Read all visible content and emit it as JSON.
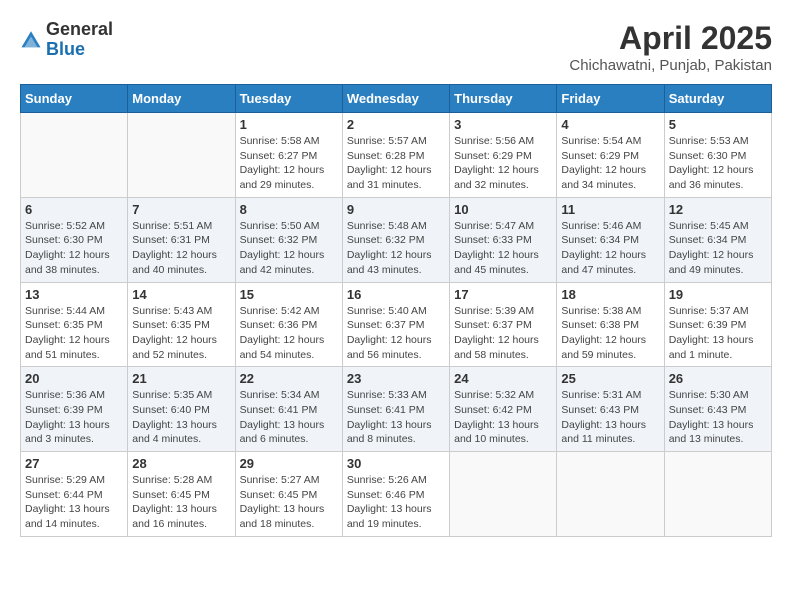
{
  "header": {
    "logo_general": "General",
    "logo_blue": "Blue",
    "title": "April 2025",
    "subtitle": "Chichawatni, Punjab, Pakistan"
  },
  "calendar": {
    "days": [
      "Sunday",
      "Monday",
      "Tuesday",
      "Wednesday",
      "Thursday",
      "Friday",
      "Saturday"
    ],
    "weeks": [
      [
        {
          "date": "",
          "sunrise": "",
          "sunset": "",
          "daylight": ""
        },
        {
          "date": "",
          "sunrise": "",
          "sunset": "",
          "daylight": ""
        },
        {
          "date": "1",
          "sunrise": "Sunrise: 5:58 AM",
          "sunset": "Sunset: 6:27 PM",
          "daylight": "Daylight: 12 hours and 29 minutes."
        },
        {
          "date": "2",
          "sunrise": "Sunrise: 5:57 AM",
          "sunset": "Sunset: 6:28 PM",
          "daylight": "Daylight: 12 hours and 31 minutes."
        },
        {
          "date": "3",
          "sunrise": "Sunrise: 5:56 AM",
          "sunset": "Sunset: 6:29 PM",
          "daylight": "Daylight: 12 hours and 32 minutes."
        },
        {
          "date": "4",
          "sunrise": "Sunrise: 5:54 AM",
          "sunset": "Sunset: 6:29 PM",
          "daylight": "Daylight: 12 hours and 34 minutes."
        },
        {
          "date": "5",
          "sunrise": "Sunrise: 5:53 AM",
          "sunset": "Sunset: 6:30 PM",
          "daylight": "Daylight: 12 hours and 36 minutes."
        }
      ],
      [
        {
          "date": "6",
          "sunrise": "Sunrise: 5:52 AM",
          "sunset": "Sunset: 6:30 PM",
          "daylight": "Daylight: 12 hours and 38 minutes."
        },
        {
          "date": "7",
          "sunrise": "Sunrise: 5:51 AM",
          "sunset": "Sunset: 6:31 PM",
          "daylight": "Daylight: 12 hours and 40 minutes."
        },
        {
          "date": "8",
          "sunrise": "Sunrise: 5:50 AM",
          "sunset": "Sunset: 6:32 PM",
          "daylight": "Daylight: 12 hours and 42 minutes."
        },
        {
          "date": "9",
          "sunrise": "Sunrise: 5:48 AM",
          "sunset": "Sunset: 6:32 PM",
          "daylight": "Daylight: 12 hours and 43 minutes."
        },
        {
          "date": "10",
          "sunrise": "Sunrise: 5:47 AM",
          "sunset": "Sunset: 6:33 PM",
          "daylight": "Daylight: 12 hours and 45 minutes."
        },
        {
          "date": "11",
          "sunrise": "Sunrise: 5:46 AM",
          "sunset": "Sunset: 6:34 PM",
          "daylight": "Daylight: 12 hours and 47 minutes."
        },
        {
          "date": "12",
          "sunrise": "Sunrise: 5:45 AM",
          "sunset": "Sunset: 6:34 PM",
          "daylight": "Daylight: 12 hours and 49 minutes."
        }
      ],
      [
        {
          "date": "13",
          "sunrise": "Sunrise: 5:44 AM",
          "sunset": "Sunset: 6:35 PM",
          "daylight": "Daylight: 12 hours and 51 minutes."
        },
        {
          "date": "14",
          "sunrise": "Sunrise: 5:43 AM",
          "sunset": "Sunset: 6:35 PM",
          "daylight": "Daylight: 12 hours and 52 minutes."
        },
        {
          "date": "15",
          "sunrise": "Sunrise: 5:42 AM",
          "sunset": "Sunset: 6:36 PM",
          "daylight": "Daylight: 12 hours and 54 minutes."
        },
        {
          "date": "16",
          "sunrise": "Sunrise: 5:40 AM",
          "sunset": "Sunset: 6:37 PM",
          "daylight": "Daylight: 12 hours and 56 minutes."
        },
        {
          "date": "17",
          "sunrise": "Sunrise: 5:39 AM",
          "sunset": "Sunset: 6:37 PM",
          "daylight": "Daylight: 12 hours and 58 minutes."
        },
        {
          "date": "18",
          "sunrise": "Sunrise: 5:38 AM",
          "sunset": "Sunset: 6:38 PM",
          "daylight": "Daylight: 12 hours and 59 minutes."
        },
        {
          "date": "19",
          "sunrise": "Sunrise: 5:37 AM",
          "sunset": "Sunset: 6:39 PM",
          "daylight": "Daylight: 13 hours and 1 minute."
        }
      ],
      [
        {
          "date": "20",
          "sunrise": "Sunrise: 5:36 AM",
          "sunset": "Sunset: 6:39 PM",
          "daylight": "Daylight: 13 hours and 3 minutes."
        },
        {
          "date": "21",
          "sunrise": "Sunrise: 5:35 AM",
          "sunset": "Sunset: 6:40 PM",
          "daylight": "Daylight: 13 hours and 4 minutes."
        },
        {
          "date": "22",
          "sunrise": "Sunrise: 5:34 AM",
          "sunset": "Sunset: 6:41 PM",
          "daylight": "Daylight: 13 hours and 6 minutes."
        },
        {
          "date": "23",
          "sunrise": "Sunrise: 5:33 AM",
          "sunset": "Sunset: 6:41 PM",
          "daylight": "Daylight: 13 hours and 8 minutes."
        },
        {
          "date": "24",
          "sunrise": "Sunrise: 5:32 AM",
          "sunset": "Sunset: 6:42 PM",
          "daylight": "Daylight: 13 hours and 10 minutes."
        },
        {
          "date": "25",
          "sunrise": "Sunrise: 5:31 AM",
          "sunset": "Sunset: 6:43 PM",
          "daylight": "Daylight: 13 hours and 11 minutes."
        },
        {
          "date": "26",
          "sunrise": "Sunrise: 5:30 AM",
          "sunset": "Sunset: 6:43 PM",
          "daylight": "Daylight: 13 hours and 13 minutes."
        }
      ],
      [
        {
          "date": "27",
          "sunrise": "Sunrise: 5:29 AM",
          "sunset": "Sunset: 6:44 PM",
          "daylight": "Daylight: 13 hours and 14 minutes."
        },
        {
          "date": "28",
          "sunrise": "Sunrise: 5:28 AM",
          "sunset": "Sunset: 6:45 PM",
          "daylight": "Daylight: 13 hours and 16 minutes."
        },
        {
          "date": "29",
          "sunrise": "Sunrise: 5:27 AM",
          "sunset": "Sunset: 6:45 PM",
          "daylight": "Daylight: 13 hours and 18 minutes."
        },
        {
          "date": "30",
          "sunrise": "Sunrise: 5:26 AM",
          "sunset": "Sunset: 6:46 PM",
          "daylight": "Daylight: 13 hours and 19 minutes."
        },
        {
          "date": "",
          "sunrise": "",
          "sunset": "",
          "daylight": ""
        },
        {
          "date": "",
          "sunrise": "",
          "sunset": "",
          "daylight": ""
        },
        {
          "date": "",
          "sunrise": "",
          "sunset": "",
          "daylight": ""
        }
      ]
    ]
  }
}
